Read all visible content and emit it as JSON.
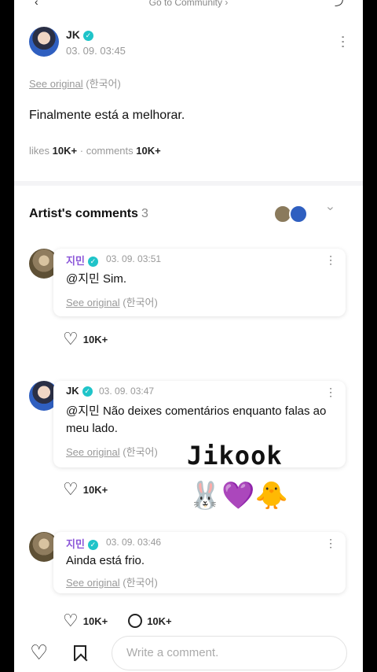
{
  "header": {
    "back_icon": "‹",
    "goto_label": "Go to Community ›",
    "share_icon": "⤴"
  },
  "post": {
    "author": "JK",
    "verified_icon": "✓",
    "timestamp": "03. 09. 03:45",
    "see_original": "See original",
    "original_lang": "(한국어)",
    "body": "Finalmente está a melhorar.",
    "likes_label": "likes",
    "likes_count": "10K+",
    "separator": "·",
    "comments_label": "comments",
    "comments_count": "10K+",
    "more_icon": "⋯"
  },
  "artist_comments": {
    "title": "Artist's comments",
    "count": "3",
    "collapse_icon": "‹",
    "comments": [
      {
        "author": "지민",
        "timestamp": "03. 09. 03:51",
        "text": "@지민 Sim.",
        "see_original": "See original",
        "original_lang": "(한국어)",
        "likes": "10K+"
      },
      {
        "author": "JK",
        "timestamp": "03. 09. 03:47",
        "text": "@지민 Não deixes comentários enquanto falas ao meu lado.",
        "see_original": "See original",
        "original_lang": "(한국어)",
        "likes": "10K+"
      },
      {
        "author": "지민",
        "timestamp": "03. 09. 03:46",
        "text": "Ainda está frio.",
        "see_original": "See original",
        "original_lang": "(한국어)",
        "likes": "10K+",
        "replies": "10K+"
      }
    ]
  },
  "overlay": {
    "caption": "Jikook",
    "emojis": "🐰💜🐥"
  },
  "bottom_bar": {
    "heart_icon": "♡",
    "comment_placeholder": "Write a comment."
  },
  "colors": {
    "verified": "#1fc4c9",
    "jimin_name": "#8a55d8",
    "muted": "#999999"
  }
}
